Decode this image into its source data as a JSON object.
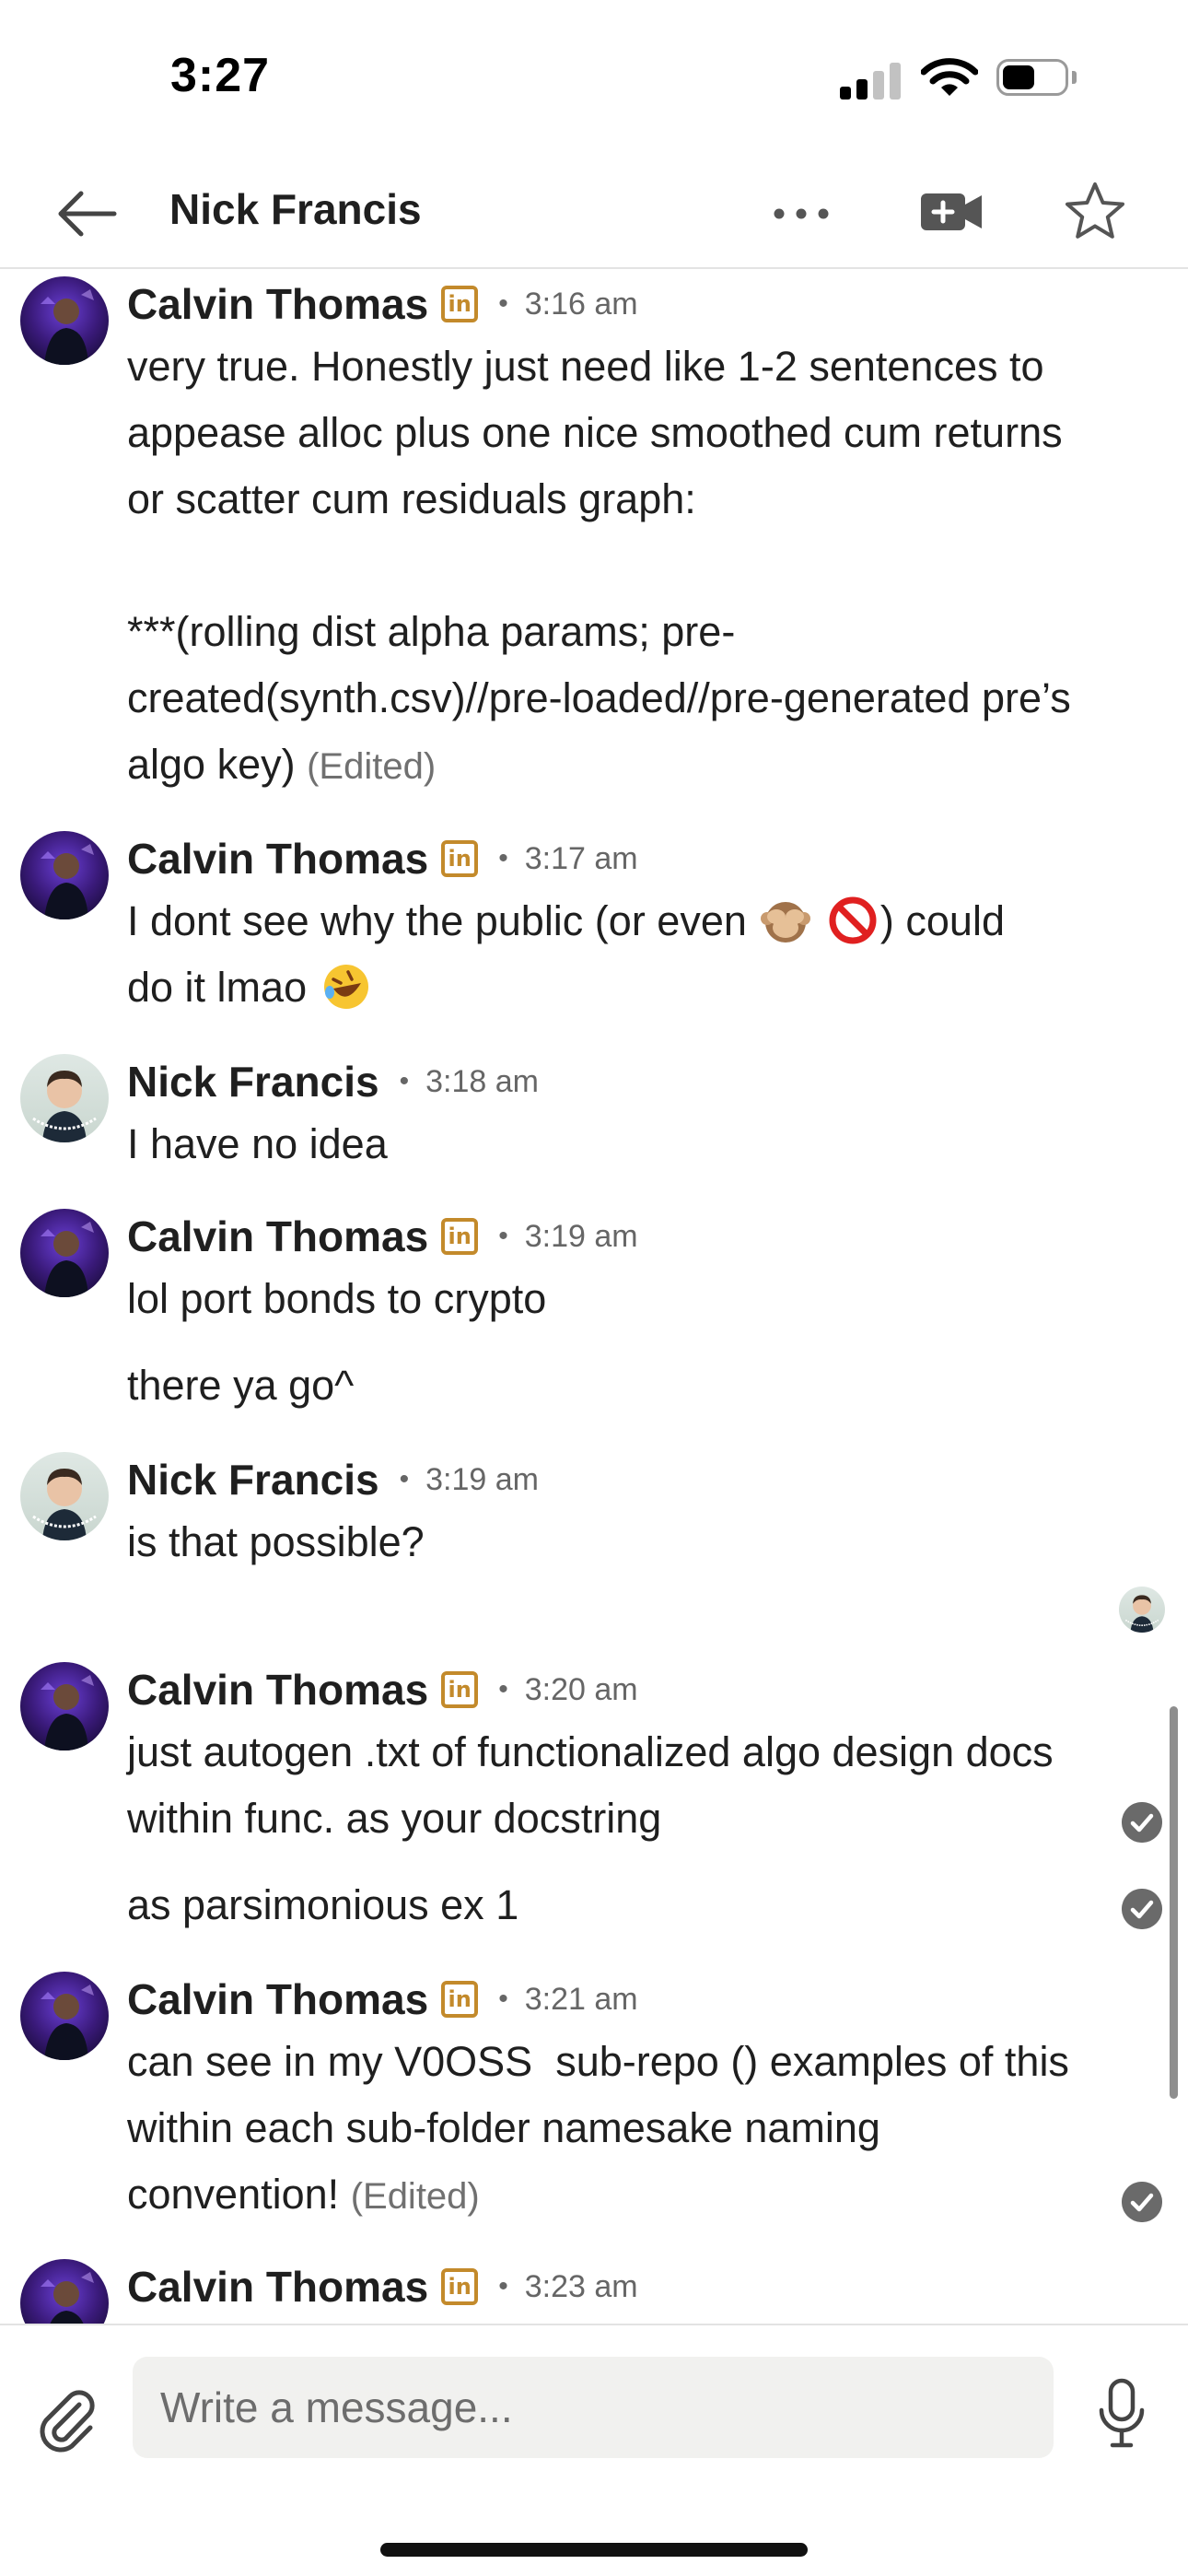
{
  "status_bar": {
    "time": "3:27"
  },
  "header": {
    "title": "Nick Francis"
  },
  "icons": {
    "back": "arrow-left-icon",
    "more": "ellipsis-icon",
    "video": "video-call-icon",
    "star": "star-icon",
    "linkedin": "linkedin-badge-icon",
    "check": "read-check-icon",
    "attach": "paperclip-icon",
    "mic": "microphone-icon"
  },
  "linkedin_badge_text": "in",
  "separator": "•",
  "colors": {
    "linkedin_badge": "#c38a2b",
    "text": "#1f1f1f",
    "muted": "#666666",
    "composer_bg": "#f1f1ef"
  },
  "messages": [
    {
      "sender": "Calvin Thomas",
      "time": "3:16 am",
      "text": "very true. Honestly just need like 1-2 sentences to appease alloc plus one nice smoothed cum returns or scatter cum residuals graph:\n\n***(rolling dist alpha params; pre-created(synth.csv)//pre-loaded//pre-generated pre’s algo key)",
      "edited": "(Edited)"
    },
    {
      "sender": "Calvin Thomas",
      "time": "3:17 am",
      "text_a": "I dont see why the public (or even",
      "text_b": ") could",
      "text_c": "do it lmao"
    },
    {
      "sender": "Nick Francis",
      "time": "3:18 am",
      "text": "I have no idea"
    },
    {
      "sender": "Calvin Thomas",
      "time": "3:19 am",
      "text": "lol port bonds to crypto",
      "text_2": "there ya go^"
    },
    {
      "sender": "Nick Francis",
      "time": "3:19 am",
      "text": "is that possible?"
    },
    {
      "sender": "Calvin Thomas",
      "time": "3:20 am",
      "text": "just autogen .txt of functionalized algo design docs within func. as your docstring",
      "text_2": "as parsimonious ex 1"
    },
    {
      "sender": "Calvin Thomas",
      "time": "3:21 am",
      "text": "can see in my V0OSS  sub-repo () examples of this within each sub-folder namesake naming convention!",
      "edited": "(Edited)"
    },
    {
      "sender": "Calvin Thomas",
      "time": "3:23 am"
    }
  ],
  "composer": {
    "placeholder": "Write a message..."
  }
}
